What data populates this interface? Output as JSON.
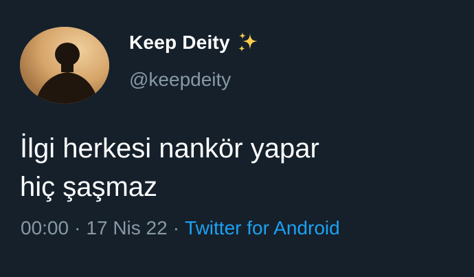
{
  "colors": {
    "background": "#15202b",
    "text_primary": "#ffffff",
    "text_secondary": "#8899a6",
    "link": "#1da1f2",
    "avatar_tone": "#d9ab72"
  },
  "author": {
    "display_name": "Keep Deity",
    "badge_icon": "sparkles-icon",
    "handle": "@keepdeity",
    "avatar_icon": "avatar-silhouette"
  },
  "tweet": {
    "lines": [
      "İlgi herkesi nankör yapar",
      "hiç şaşmaz"
    ]
  },
  "meta": {
    "time": "00:00",
    "separator": "·",
    "date": "17 Nis 22",
    "source": "Twitter for Android"
  }
}
